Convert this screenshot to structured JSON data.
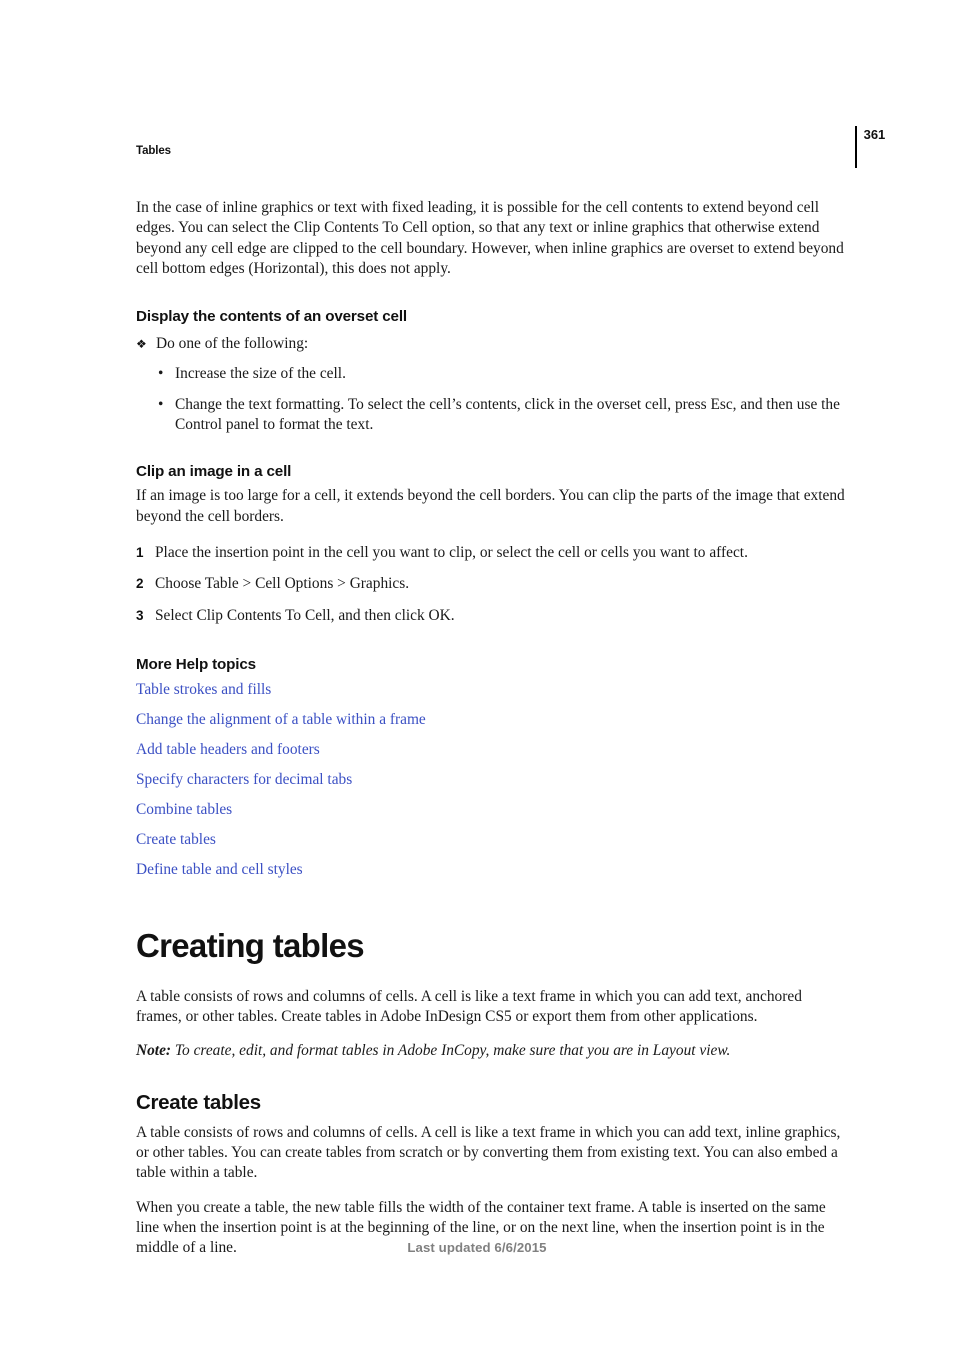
{
  "header": {
    "running_head": "Tables",
    "page_number": "361"
  },
  "intro": {
    "paragraph": "In the case of inline graphics or text with fixed leading, it is possible for the cell contents to extend beyond cell edges. You can select the Clip Contents To Cell option, so that any text or inline graphics that otherwise extend beyond any cell edge are clipped to the cell boundary. However, when inline graphics are overset to extend beyond cell bottom edges (Horizontal), this does not apply."
  },
  "section_overset": {
    "heading": "Display the contents of an overset cell",
    "lead_marker": "❖",
    "lead_text": "Do one of the following:",
    "bullet_marker": "•",
    "bullets": [
      "Increase the size of the cell.",
      "Change the text formatting. To select the cell’s contents, click in the overset cell, press Esc, and then use the Control panel to format the text."
    ]
  },
  "section_clip": {
    "heading": "Clip an image in a cell",
    "paragraph": "If an image is too large for a cell, it extends beyond the cell borders. You can clip the parts of the image that extend beyond the cell borders.",
    "steps": [
      {
        "number": "1",
        "text": "Place the insertion point in the cell you want to clip, or select the cell or cells you want to affect."
      },
      {
        "number": "2",
        "text": "Choose Table > Cell Options > Graphics."
      },
      {
        "number": "3",
        "text": "Select Clip Contents To Cell, and then click OK."
      }
    ]
  },
  "more_help": {
    "heading": "More Help topics",
    "link_color": "#3b50c4",
    "links": [
      "Table strokes and fills",
      "Change the alignment of a table within a frame",
      "Add table headers and footers",
      "Specify characters for decimal tabs",
      "Combine tables",
      "Create tables",
      "Define table and cell styles"
    ]
  },
  "chapter": {
    "title": "Creating tables",
    "paragraph": "A table consists of rows and columns of cells. A cell is like a text frame in which you can add text, anchored frames, or other tables. Create tables in Adobe InDesign CS5 or export them from other applications.",
    "note_label": "Note:",
    "note_text": " To create, edit, and format tables in Adobe InCopy, make sure that you are in Layout view."
  },
  "section_create": {
    "heading": "Create tables",
    "paragraph_1": "A table consists of rows and columns of cells. A cell is like a text frame in which you can add text, inline graphics, or other tables. You can create tables from scratch or by converting them from existing text. You can also embed a table within a table.",
    "paragraph_2": "When you create a table, the new table fills the width of the container text frame. A table is inserted on the same line when the insertion point is at the beginning of the line, or on the next line, when the insertion point is in the middle of a line."
  },
  "footer": {
    "text": "Last updated 6/6/2015"
  }
}
